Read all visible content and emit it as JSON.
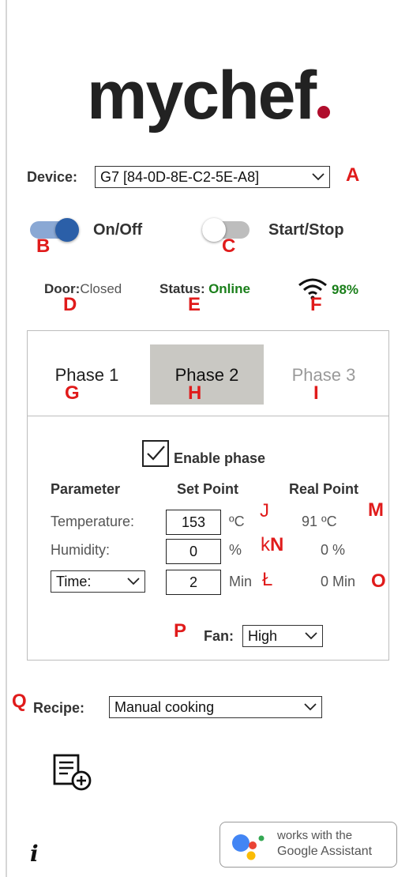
{
  "brand": {
    "logo_text": "mychef",
    "dot_color": "#b00d2c"
  },
  "device": {
    "label": "Device:",
    "value": "G7 [84-0D-8E-C2-5E-A8]"
  },
  "controls": {
    "onoff_label": "On/Off",
    "onoff_state": "on",
    "startstop_label": "Start/Stop",
    "startstop_state": "off"
  },
  "status": {
    "door_label": "Door:",
    "door_value": "Closed",
    "status_label": "Status:",
    "status_value": "Online",
    "wifi_strength": "98%",
    "online_color": "#1a7f1a"
  },
  "tabs": [
    {
      "label": "Phase 1",
      "state": "normal"
    },
    {
      "label": "Phase 2",
      "state": "selected"
    },
    {
      "label": "Phase 3",
      "state": "disabled"
    }
  ],
  "phase": {
    "enable_label": "Enable phase",
    "enabled": true,
    "headers": {
      "parameter": "Parameter",
      "set_point": "Set Point",
      "real_point": "Real Point"
    },
    "temperature": {
      "label": "Temperature:",
      "set": "153",
      "unit": "ºC",
      "real": "91 ºC"
    },
    "humidity": {
      "label": "Humidity:",
      "set": "0",
      "unit": "%",
      "real": "0 %"
    },
    "time": {
      "select": "Time:",
      "set": "2",
      "unit": "Min",
      "real": "0 Min"
    },
    "fan": {
      "label": "Fan:",
      "value": "High"
    }
  },
  "recipe": {
    "label": "Recipe:",
    "value": "Manual cooking"
  },
  "footer": {
    "info_icon": "i",
    "ga_line1": "works with the",
    "ga_line2": "Google Assistant"
  },
  "annotations": {
    "A": "A",
    "B": "B",
    "C": "C",
    "D": "D",
    "E": "E",
    "F": "F",
    "G": "G",
    "H": "H",
    "I": "I",
    "J": "J",
    "k": "k",
    "N": "N",
    "L": "Ł",
    "M": "M",
    "O": "O",
    "P": "P",
    "Q": "Q"
  },
  "colors": {
    "accent": "#2b5fa8",
    "annotation": "#e01b1b",
    "tab_selected": "#c9c8c3"
  }
}
